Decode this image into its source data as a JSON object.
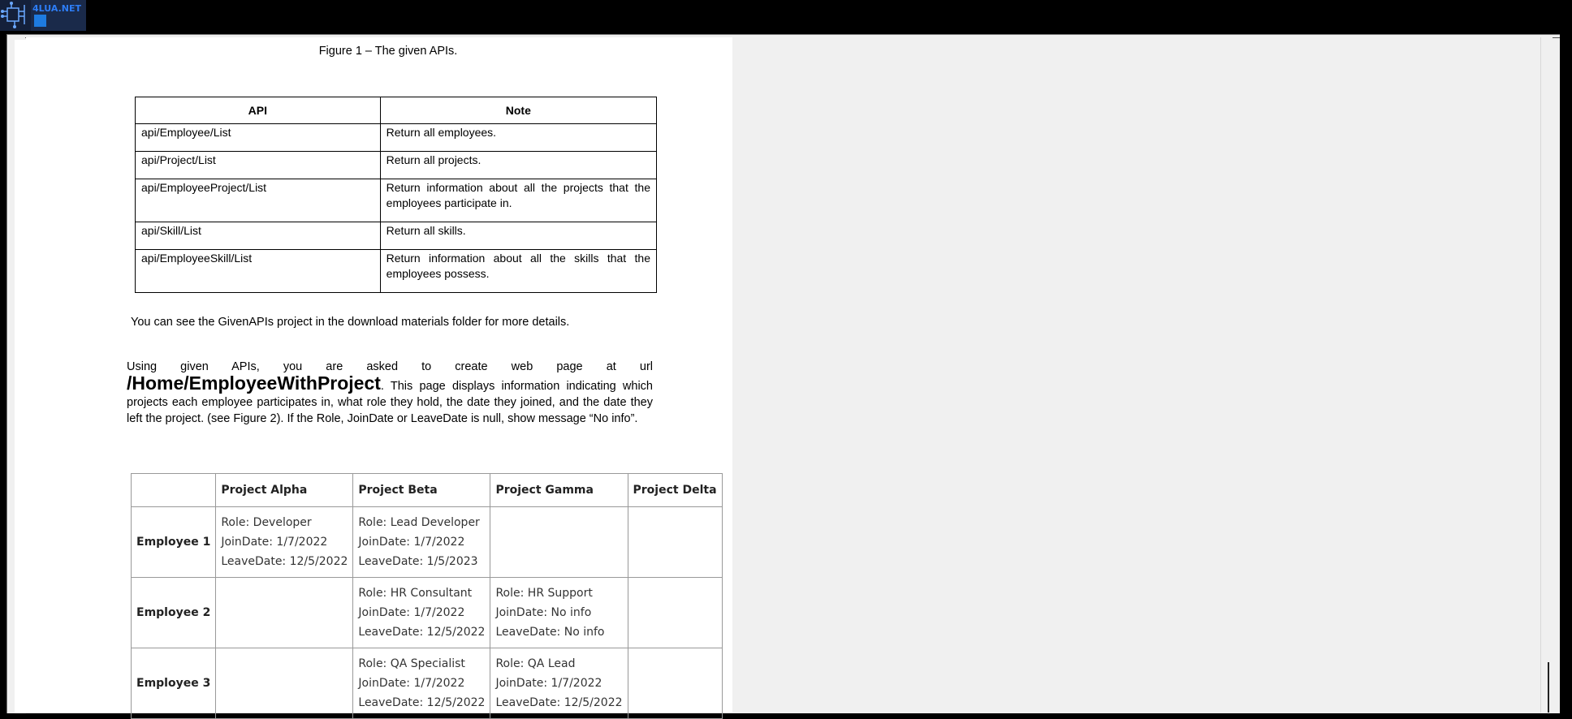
{
  "logo": {
    "text": "4LUA.NET"
  },
  "document": {
    "figure_caption": "Figure 1 – The given APIs.",
    "api_table": {
      "headers": [
        "API",
        "Note"
      ],
      "rows": [
        {
          "api": "api/Employee/List",
          "note": "Return all employees."
        },
        {
          "api": "api/Project/List",
          "note": "Return all projects."
        },
        {
          "api": "api/EmployeeProject/List",
          "note": "Return information about all the projects that the employees participate in."
        },
        {
          "api": "api/Skill/List",
          "note": "Return all skills."
        },
        {
          "api": "api/EmployeeSkill/List",
          "note": "Return information about all the skills that the employees possess."
        }
      ]
    },
    "para1": "You can see the GivenAPIs project in the download materials folder for more details.",
    "para2": {
      "before_url": "Using given APIs, you are asked to create web page at url",
      "url": "/Home/EmployeeWithProject",
      "after_url": ". This page displays information indicating which projects each employee participates in, what role they hold, the date they joined, and the date they left the project. (see Figure 2). If the Role, JoinDate or LeaveDate is null, show message “No info”."
    },
    "employee_table": {
      "headers": [
        "",
        "Project Alpha",
        "Project Beta",
        "Project Gamma",
        "Project Delta"
      ],
      "rows": [
        {
          "employee": "Employee 1",
          "cells": [
            [
              "Role: Developer",
              "JoinDate: 1/7/2022",
              "LeaveDate: 12/5/2022"
            ],
            [
              "Role: Lead Developer",
              "JoinDate: 1/7/2022",
              "LeaveDate: 1/5/2023"
            ],
            [],
            []
          ]
        },
        {
          "employee": "Employee 2",
          "cells": [
            [],
            [
              "Role: HR Consultant",
              "JoinDate: 1/7/2022",
              "LeaveDate: 12/5/2022"
            ],
            [
              "Role: HR Support",
              "JoinDate: No info",
              "LeaveDate: No info"
            ],
            []
          ]
        },
        {
          "employee": "Employee 3",
          "cells": [
            [],
            [
              "Role: QA Specialist",
              "JoinDate: 1/7/2022",
              "LeaveDate: 12/5/2022"
            ],
            [
              "Role: QA Lead",
              "JoinDate: 1/7/2022",
              "LeaveDate: 12/5/2022"
            ],
            []
          ]
        }
      ]
    }
  }
}
